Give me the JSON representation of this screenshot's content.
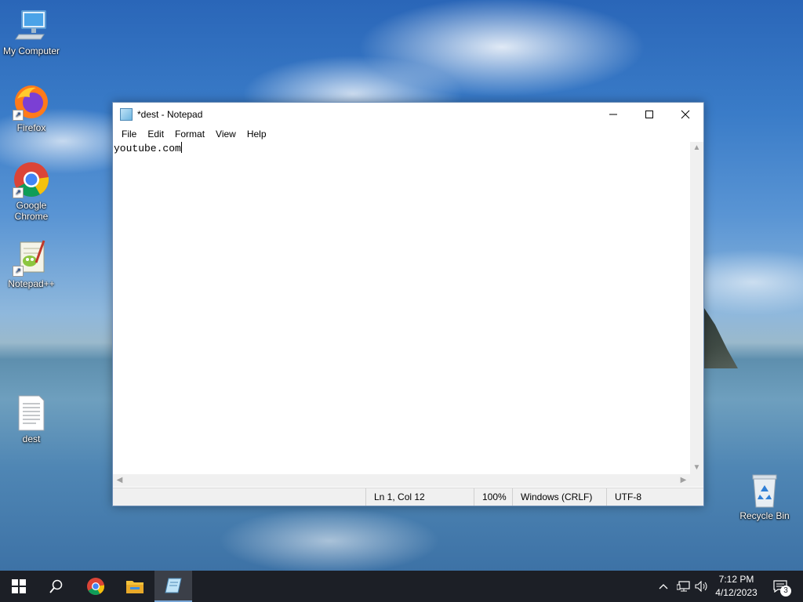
{
  "desktop": {
    "icons": [
      {
        "label": "My Computer",
        "icon": "computer-icon"
      },
      {
        "label": "Firefox",
        "icon": "firefox-icon"
      },
      {
        "label": "Google Chrome",
        "icon": "chrome-icon"
      },
      {
        "label": "Notepad++",
        "icon": "notepadpp-icon"
      },
      {
        "label": "dest",
        "icon": "text-file-icon"
      },
      {
        "label": "Recycle Bin",
        "icon": "recycle-bin-icon"
      }
    ]
  },
  "notepad": {
    "title": "*dest - Notepad",
    "menu": [
      "File",
      "Edit",
      "Format",
      "View",
      "Help"
    ],
    "content": "youtube.com",
    "status": {
      "position": "Ln 1, Col 12",
      "zoom": "100%",
      "line_ending": "Windows (CRLF)",
      "encoding": "UTF-8"
    }
  },
  "taskbar": {
    "items": [
      "start-icon",
      "search-icon",
      "chrome-icon",
      "file-explorer-icon",
      "notepad-icon"
    ],
    "clock_time": "7:12 PM",
    "clock_date": "4/12/2023",
    "notification_count": "3"
  },
  "colors": {
    "taskbar_bg": "#1c1f26",
    "accent": "#7aa7d8"
  }
}
